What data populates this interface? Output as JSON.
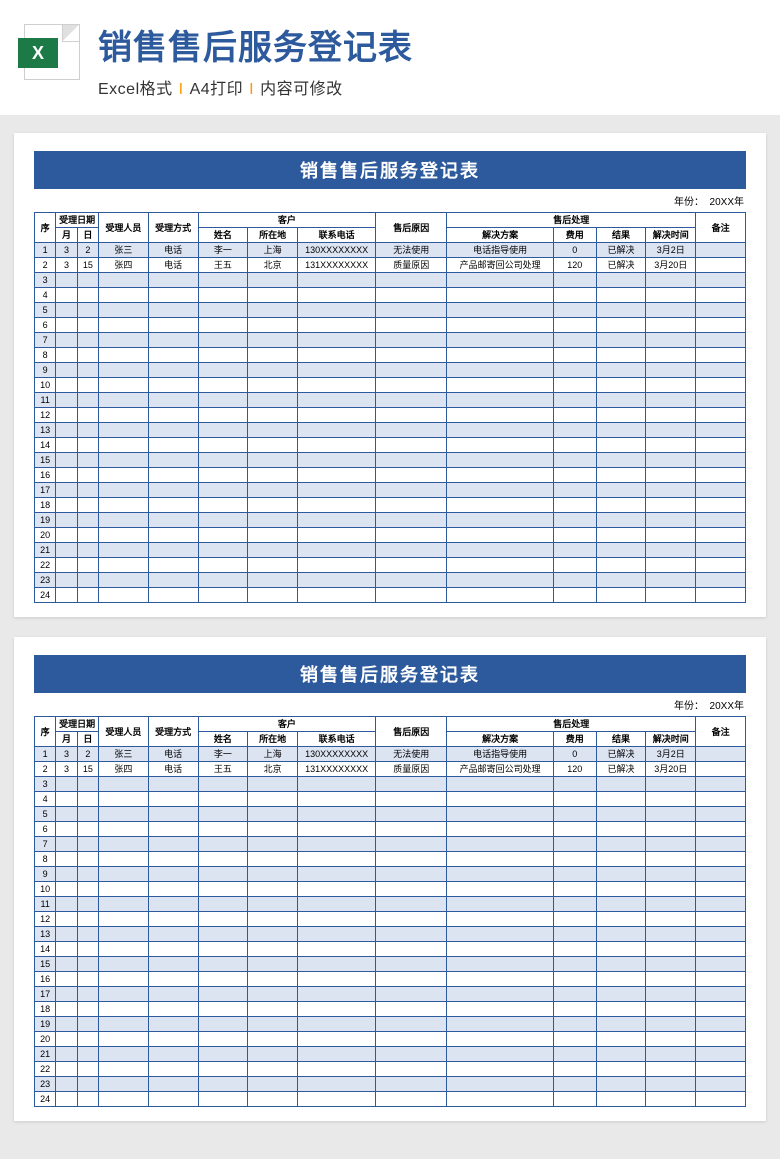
{
  "hero": {
    "title": "销售售后服务登记表",
    "sub1": "Excel格式",
    "sub2": "A4打印",
    "sub3": "内容可修改",
    "xl": "X"
  },
  "sheet": {
    "title": "销售售后服务登记表",
    "year_label": "年份：",
    "year_value": "20XX年",
    "headers": {
      "seq": "序",
      "date_group": "受理日期",
      "month": "月",
      "day": "日",
      "staff": "受理人员",
      "method": "受理方式",
      "cust_group": "客户",
      "name": "姓名",
      "loc": "所在地",
      "tel": "联系电话",
      "reason": "售后原因",
      "after_group": "售后处理",
      "sol": "解决方案",
      "fee": "费用",
      "res": "结果",
      "time": "解决时间",
      "note": "备注"
    },
    "rows": [
      {
        "seq": "1",
        "m": "3",
        "d": "2",
        "staff": "张三",
        "method": "电话",
        "name": "李一",
        "loc": "上海",
        "tel": "130XXXXXXXX",
        "reason": "无法使用",
        "sol": "电话指导使用",
        "fee": "0",
        "res": "已解决",
        "time": "3月2日",
        "note": ""
      },
      {
        "seq": "2",
        "m": "3",
        "d": "15",
        "staff": "张四",
        "method": "电话",
        "name": "王五",
        "loc": "北京",
        "tel": "131XXXXXXXX",
        "reason": "质量原因",
        "sol": "产品邮寄回公司处理",
        "fee": "120",
        "res": "已解决",
        "time": "3月20日",
        "note": ""
      },
      {
        "seq": "3"
      },
      {
        "seq": "4"
      },
      {
        "seq": "5"
      },
      {
        "seq": "6"
      },
      {
        "seq": "7"
      },
      {
        "seq": "8"
      },
      {
        "seq": "9"
      },
      {
        "seq": "10"
      },
      {
        "seq": "11"
      },
      {
        "seq": "12"
      },
      {
        "seq": "13"
      },
      {
        "seq": "14"
      },
      {
        "seq": "15"
      },
      {
        "seq": "16"
      },
      {
        "seq": "17"
      },
      {
        "seq": "18"
      },
      {
        "seq": "19"
      },
      {
        "seq": "20"
      },
      {
        "seq": "21"
      },
      {
        "seq": "22"
      },
      {
        "seq": "23"
      },
      {
        "seq": "24"
      }
    ]
  }
}
